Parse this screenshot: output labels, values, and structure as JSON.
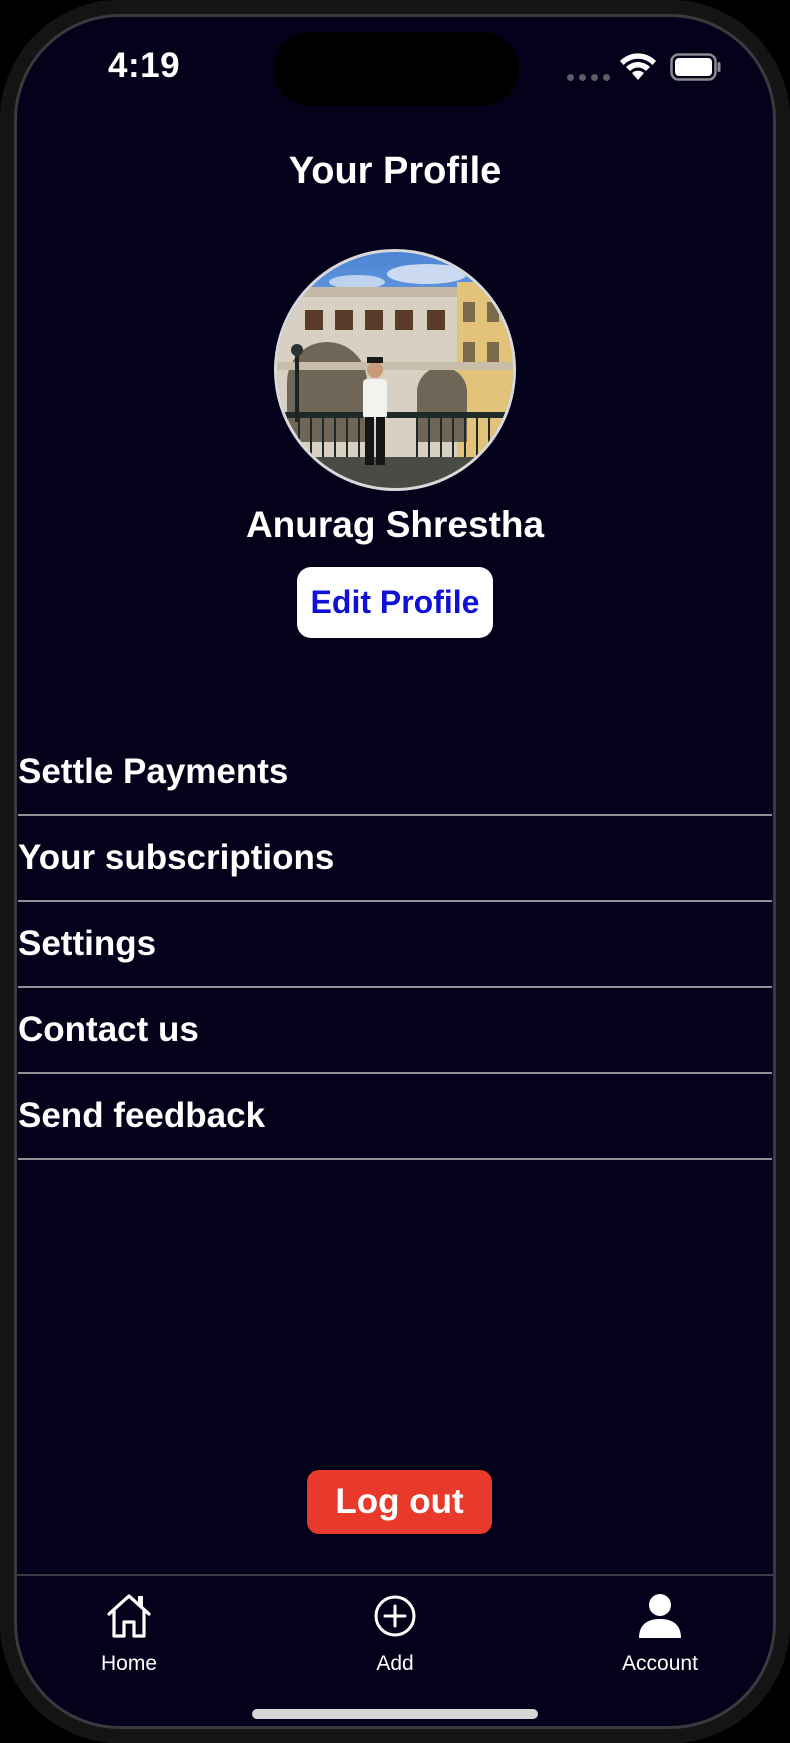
{
  "status_bar": {
    "time": "4:19"
  },
  "header": {
    "title": "Your Profile"
  },
  "profile": {
    "name": "Anurag Shrestha",
    "edit_button_label": "Edit Profile"
  },
  "menu": {
    "items": [
      {
        "label": "Settle Payments"
      },
      {
        "label": "Your subscriptions"
      },
      {
        "label": "Settings"
      },
      {
        "label": "Contact us"
      },
      {
        "label": "Send feedback"
      }
    ]
  },
  "logout_label": "Log out",
  "tab_bar": {
    "tabs": [
      {
        "label": "Home",
        "icon": "home-icon"
      },
      {
        "label": "Add",
        "icon": "plus-circle-icon"
      },
      {
        "label": "Account",
        "icon": "person-icon",
        "active": true
      }
    ]
  },
  "colors": {
    "background": "#03021a",
    "edit_button_text": "#0f10d8",
    "logout_button": "#e8392a",
    "divider": "#8f8f96"
  }
}
